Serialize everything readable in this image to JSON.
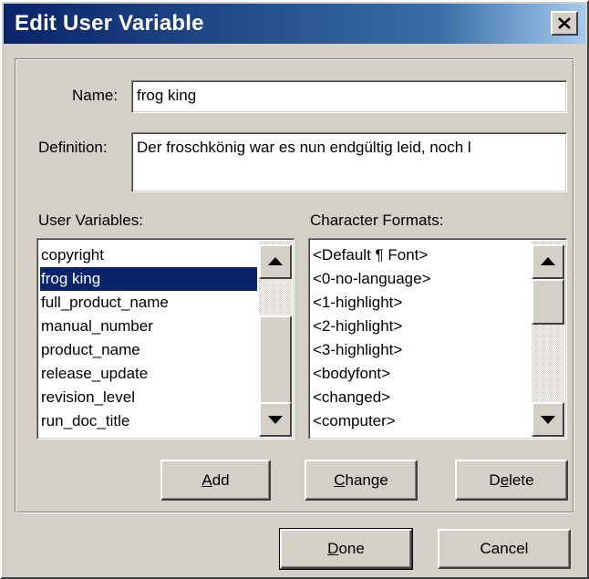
{
  "window": {
    "title": "Edit User Variable"
  },
  "name_field": {
    "label": "Name:",
    "value": "frog king"
  },
  "definition_field": {
    "label": "Definition:",
    "value": "Der froschkönig war es nun endgültig leid, noch l"
  },
  "user_variables": {
    "label": "User Variables:",
    "items": [
      "copyright",
      "frog king",
      "full_product_name",
      "manual_number",
      "product_name",
      "release_update",
      "revision_level",
      "run_doc_title"
    ],
    "selected": "frog king"
  },
  "character_formats": {
    "label": "Character Formats:",
    "items": [
      "<Default ¶ Font>",
      "<0-no-language>",
      "<1-highlight>",
      "<2-highlight>",
      "<3-highlight>",
      "<bodyfont>",
      "<changed>",
      "<computer>"
    ]
  },
  "buttons": {
    "add": {
      "pre": "",
      "key": "A",
      "post": "dd"
    },
    "change": {
      "pre": "",
      "key": "C",
      "post": "hange"
    },
    "delete": {
      "pre": "D",
      "key": "e",
      "post": "lete"
    },
    "done": {
      "pre": "",
      "key": "D",
      "post": "one"
    },
    "cancel": {
      "label": "Cancel"
    }
  },
  "icons": {
    "close": "close-icon",
    "scroll_up": "arrow-up-icon",
    "scroll_down": "arrow-down-icon"
  }
}
